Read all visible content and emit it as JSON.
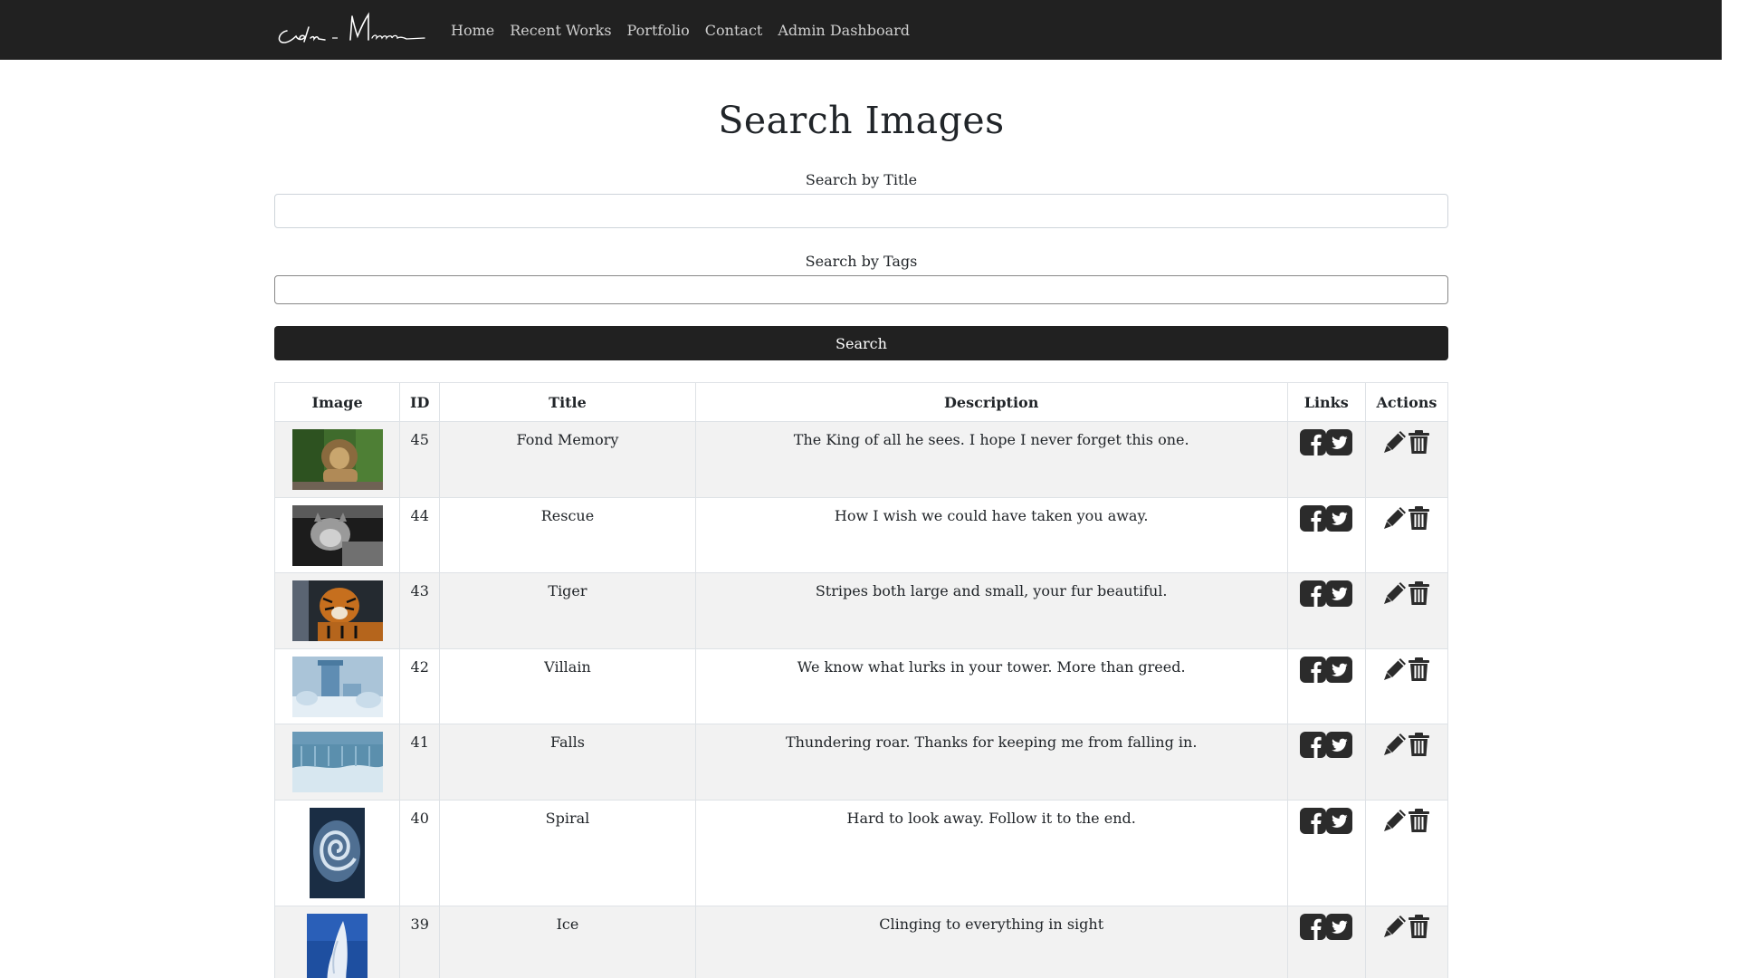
{
  "brand": {
    "signature": "Colin Murray"
  },
  "nav": {
    "items": [
      {
        "label": "Home"
      },
      {
        "label": "Recent Works"
      },
      {
        "label": "Portfolio"
      },
      {
        "label": "Contact"
      },
      {
        "label": "Admin Dashboard"
      }
    ]
  },
  "page_title": "Search Images",
  "search": {
    "title_label": "Search by Title",
    "title_value": "",
    "tags_label": "Search by Tags",
    "tags_value": "",
    "button_label": "Search"
  },
  "table": {
    "headers": [
      "Image",
      "ID",
      "Title",
      "Description",
      "Links",
      "Actions"
    ],
    "rows": [
      {
        "id": "45",
        "title": "Fond Memory",
        "description": "The King of all he sees. I hope I never forget this one.",
        "thumb": "lion"
      },
      {
        "id": "44",
        "title": "Rescue",
        "description": "How I wish we could have taken you away.",
        "thumb": "cougar"
      },
      {
        "id": "43",
        "title": "Tiger",
        "description": "Stripes both large and small, your fur beautiful.",
        "thumb": "tiger"
      },
      {
        "id": "42",
        "title": "Villain",
        "description": "We know what lurks in your tower. More than greed.",
        "thumb": "tower"
      },
      {
        "id": "41",
        "title": "Falls",
        "description": "Thundering roar. Thanks for keeping me from falling in.",
        "thumb": "falls"
      },
      {
        "id": "40",
        "title": "Spiral",
        "description": "Hard to look away. Follow it to the end.",
        "thumb": "spiral"
      },
      {
        "id": "39",
        "title": "Ice",
        "description": "Clinging to everything in sight",
        "thumb": "ice"
      }
    ]
  },
  "icons": {
    "links": [
      "facebook-icon",
      "twitter-icon"
    ],
    "actions": [
      "pencil-icon",
      "trash-icon"
    ]
  },
  "colors": {
    "navbar_bg": "#212121",
    "nav_link": "#cfcfcf",
    "button_bg": "#212121",
    "stripe_bg": "#f2f2f2",
    "icon_color": "#2b2b2b"
  }
}
